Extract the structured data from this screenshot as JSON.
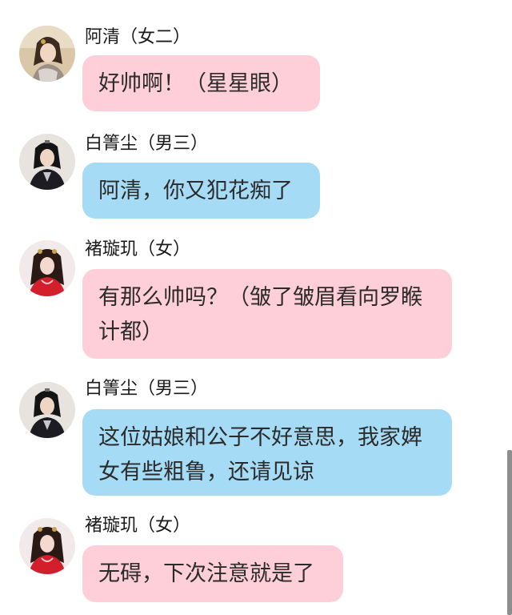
{
  "messages": [
    {
      "sender": "阿清（女二）",
      "text": "好帅啊！（星星眼）",
      "avatar": "woman-portrait-avatar",
      "bubble_color": "#ffcfd9"
    },
    {
      "sender": "白箐尘（男三）",
      "text": "阿清，你又犯花痴了",
      "avatar": "man-black-robe-avatar",
      "bubble_color": "#a5dbf5"
    },
    {
      "sender": "褚璇玑（女）",
      "text": "有那么帅吗？（皱了皱眉看向罗睺计都）",
      "avatar": "woman-red-robe-avatar",
      "bubble_color": "#ffcfd9"
    },
    {
      "sender": "白箐尘（男三）",
      "text": "这位姑娘和公子不好意思，我家婢女有些粗鲁，还请见谅",
      "avatar": "man-black-robe-avatar",
      "bubble_color": "#a5dbf5"
    },
    {
      "sender": "褚璇玑（女）",
      "text": "无碍，下次注意就是了",
      "avatar": "woman-red-robe-avatar",
      "bubble_color": "#ffcfd9"
    }
  ]
}
